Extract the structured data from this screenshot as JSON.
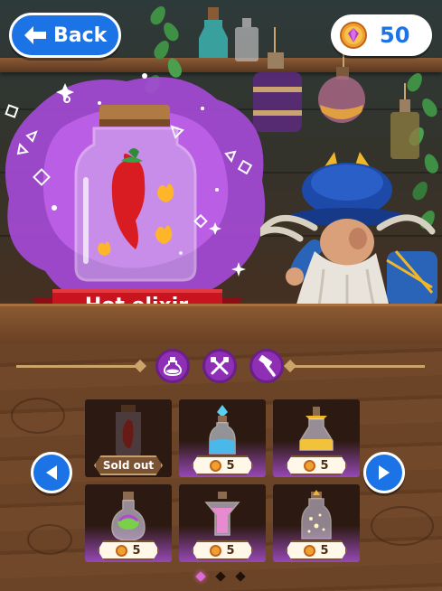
{
  "header": {
    "back_label": "Back",
    "coins": "50"
  },
  "featured": {
    "name": "Hot elixir"
  },
  "categories": [
    {
      "icon": "potion-flask-icon"
    },
    {
      "icon": "crossed-tools-icon"
    },
    {
      "icon": "hammer-icon"
    }
  ],
  "shop": {
    "items": [
      {
        "icon": "chili-bottle-icon",
        "status": "Sold out"
      },
      {
        "icon": "blue-crystal-potion-icon",
        "price": "5"
      },
      {
        "icon": "golden-potion-icon",
        "price": "5"
      },
      {
        "icon": "green-bubble-potion-icon",
        "price": "5"
      },
      {
        "icon": "pink-potion-icon",
        "price": "5"
      },
      {
        "icon": "sparkle-potion-icon",
        "price": "5"
      }
    ],
    "pagination": {
      "current": 1,
      "total": 3
    }
  },
  "colors": {
    "accent_blue": "#1b73e6",
    "magic_purple": "#a64ad9",
    "ribbon_red": "#c8141e",
    "wood": "#6b4326"
  }
}
